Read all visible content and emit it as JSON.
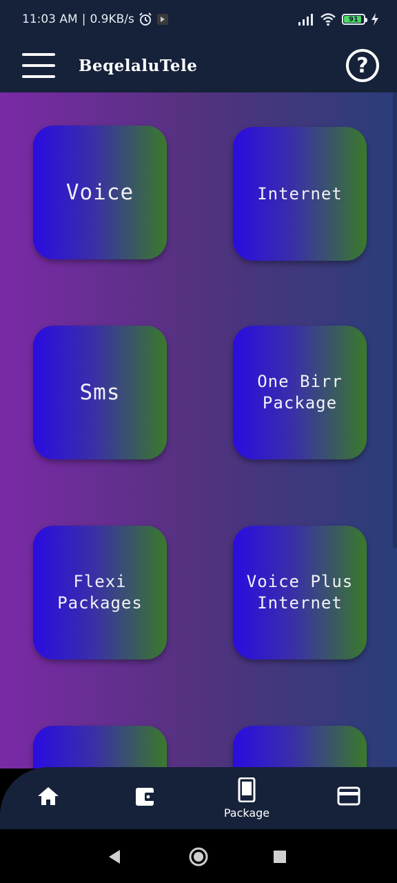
{
  "status_bar": {
    "time": "11:03 AM",
    "speed": "0.9KB/s",
    "battery": "91",
    "battery_level": 0.91
  },
  "app_bar": {
    "title": "BeqelaluTele",
    "menu_icon": "hamburger-menu-icon",
    "help_icon": "help-circle-icon",
    "help_glyph": "?"
  },
  "tiles": [
    {
      "label": "Voice"
    },
    {
      "label": "Internet"
    },
    {
      "label": "Sms"
    },
    {
      "label": "One Birr Package"
    },
    {
      "label": "Flexi Packages"
    },
    {
      "label": "Voice Plus Internet"
    },
    {
      "label": ""
    },
    {
      "label": ""
    }
  ],
  "bottom_nav": {
    "items": [
      {
        "icon": "home-icon",
        "label": ""
      },
      {
        "icon": "wallet-icon",
        "label": ""
      },
      {
        "icon": "phone-icon",
        "label": "Package"
      },
      {
        "icon": "card-icon",
        "label": ""
      }
    ]
  },
  "colors": {
    "bar": "#16223a",
    "tile_start": "#2a0ce0",
    "tile_end": "#3a7a2a",
    "bg_left": "#7a2aa6",
    "bg_right": "#2a3e7a"
  }
}
